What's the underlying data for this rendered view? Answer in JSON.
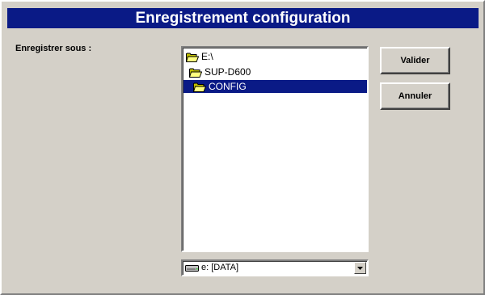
{
  "window": {
    "title": "Enregistrement configuration",
    "title_bar_color": "#0a1a86",
    "background_color": "#d4d0c8"
  },
  "form": {
    "save_as_label": "Enregistrer sous :"
  },
  "folder_tree": {
    "items": [
      {
        "label": "E:\\",
        "icon": "open-folder-icon",
        "selected": false
      },
      {
        "label": "SUP-D600",
        "icon": "open-folder-icon",
        "selected": false
      },
      {
        "label": "CONFIG",
        "icon": "open-folder-icon",
        "selected": true
      }
    ],
    "selection_color": "#0a1a86"
  },
  "buttons": {
    "ok_label": "Valider",
    "cancel_label": "Annuler"
  },
  "drive_select": {
    "value": "e: [DATA]",
    "icon": "drive-icon"
  }
}
